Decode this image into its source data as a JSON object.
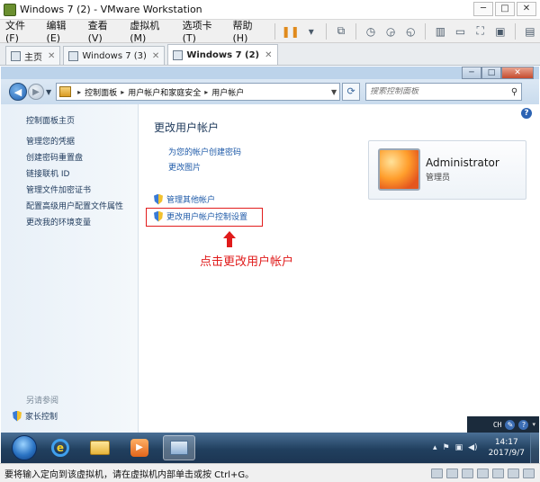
{
  "vmware": {
    "title": "Windows 7 (2) - VMware Workstation",
    "menu": [
      "文件(F)",
      "编辑(E)",
      "查看(V)",
      "虚拟机(M)",
      "选项卡(T)",
      "帮助(H)"
    ],
    "tabs": [
      {
        "label": "主页"
      },
      {
        "label": "Windows 7 (3)"
      },
      {
        "label": "Windows 7 (2)"
      }
    ],
    "status_text": "要将输入定向到该虚拟机，请在虚拟机内部单击或按 Ctrl+G。"
  },
  "explorer": {
    "breadcrumbs": [
      "控制面板",
      "用户帐户和家庭安全",
      "用户帐户"
    ],
    "search_placeholder": "搜索控制面板",
    "left_nav": {
      "home": "控制面板主页",
      "links": [
        "管理您的凭据",
        "创建密码重置盘",
        "链接联机 ID",
        "管理文件加密证书",
        "配置高级用户配置文件属性",
        "更改我的环境变量"
      ],
      "see_also": "另请参阅",
      "parental_controls": "家长控制"
    },
    "main": {
      "title": "更改用户帐户",
      "links": [
        "为您的帐户创建密码",
        "更改图片"
      ],
      "tasks": [
        "管理其他帐户",
        "更改用户帐户控制设置"
      ],
      "annotation": "点击更改用户帐户"
    },
    "account": {
      "name": "Administrator",
      "role": "管理员"
    }
  },
  "langbar": {
    "lang": "CH"
  },
  "taskbar": {
    "time": "14:17",
    "date": "2017/9/7"
  },
  "colors": {
    "annotation": "#e01b1b",
    "link": "#1e5aa8",
    "taskbar": "#21405f"
  }
}
